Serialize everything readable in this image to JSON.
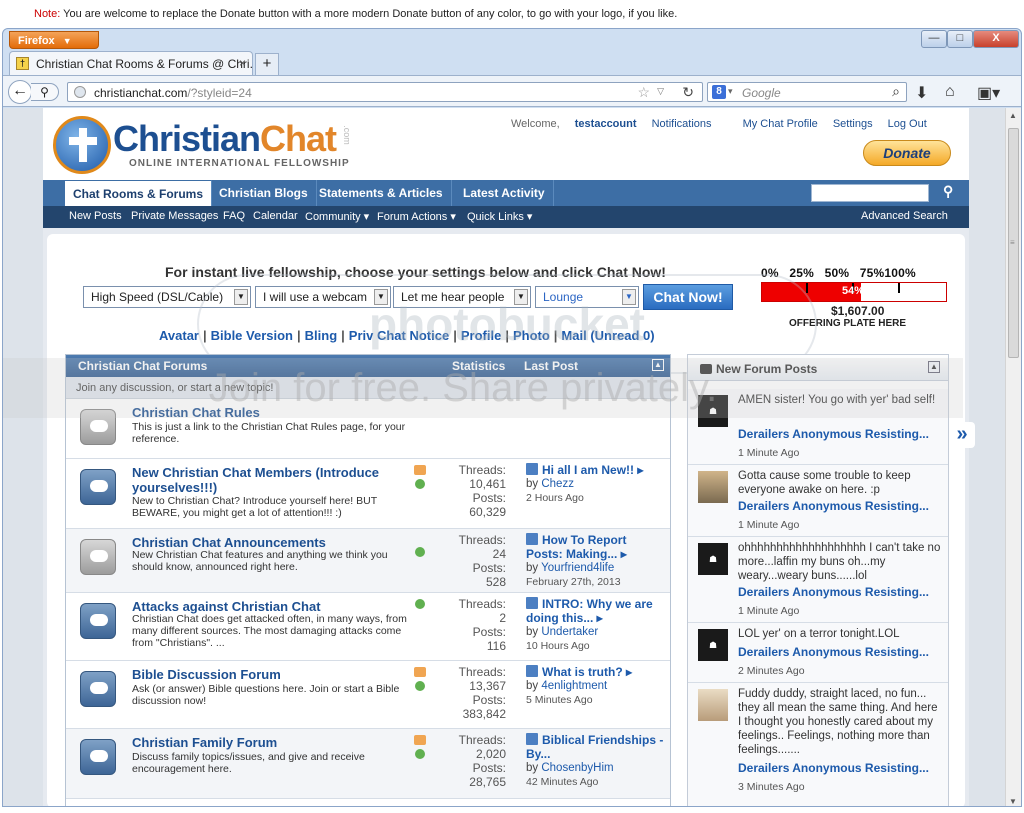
{
  "note": {
    "label": "Note:",
    "text": "You are welcome to replace the Donate button with a more modern Donate button of any color, to go with your logo, if you like."
  },
  "browser": {
    "menu_label": "Firefox",
    "tab_title": "Christian Chat Rooms & Forums @ Chri...",
    "url_host": "christianchat.com",
    "url_path": "/?styleid=24",
    "search_placeholder": "Google",
    "window_buttons": {
      "minimize": "—",
      "maximize": "□",
      "close": "X"
    }
  },
  "site": {
    "logo_main": "Christian",
    "logo_accent": "Chat",
    "logo_sub": "ONLINE INTERNATIONAL FELLOWSHIP",
    "logo_com": ".com",
    "welcome": "Welcome,",
    "username": "testaccount",
    "toplinks": [
      "Notifications",
      "My Chat Profile",
      "Settings",
      "Log Out"
    ],
    "donate": "Donate",
    "tabs": [
      "Chat Rooms & Forums",
      "Christian Blogs",
      "Statements & Articles",
      "Latest Activity"
    ],
    "subnav": [
      "New Posts",
      "Private Messages",
      "FAQ",
      "Calendar",
      "Community ▾",
      "Forum Actions ▾",
      "Quick Links ▾"
    ],
    "advanced_search": "Advanced Search"
  },
  "chat": {
    "heading": "For instant live fellowship, choose your settings below and click Chat Now!",
    "selects": [
      "High Speed (DSL/Cable)",
      "I will use a webcam",
      "Let me hear people",
      "Lounge"
    ],
    "button": "Chat Now!",
    "links": [
      "Avatar",
      "Bible Version",
      "Bling",
      "Priv Chat Notice",
      "Profile",
      "Photo",
      "Mail (Unread 0)"
    ]
  },
  "plate": {
    "scale": "0%   25%   50%   75%100%",
    "percent_label": "54%",
    "percent": 54,
    "amount": "$1,607.00",
    "label": "OFFERING PLATE HERE"
  },
  "forums": {
    "header": "Christian Chat Forums",
    "col_stats": "Statistics",
    "col_last": "Last Post",
    "sub": "Join any discussion, or start a new topic!",
    "threads_label": "Threads:",
    "posts_label": "Posts:",
    "rows": [
      {
        "title": "Christian Chat Rules",
        "desc": "This is just a link to the Christian Chat Rules page, for your reference."
      },
      {
        "title": "New Christian Chat Members (Introduce yourselves!!!)",
        "desc": "New to Christian Chat? Introduce yourself here! BUT BEWARE, you might get a lot of attention!!! :)",
        "threads": "10,461",
        "posts": "60,329",
        "last_title": "Hi all I am New!!",
        "last_by": "Chezz",
        "last_time": "2 Hours Ago"
      },
      {
        "title": "Christian Chat Announcements",
        "desc": "New Christian Chat features and anything we think you should know, announced right here.",
        "threads": "24",
        "posts": "528",
        "last_title": "How To Report Posts: Making...",
        "last_by": "Yourfriend4life",
        "last_time": "February 27th, 2013"
      },
      {
        "title": "Attacks against Christian Chat",
        "desc": "Christian Chat does get attacked often, in many ways, from many different sources. The most damaging attacks come from \"Christians\". ...",
        "threads": "2",
        "posts": "116",
        "last_title": "INTRO: Why we are doing this...",
        "last_by": "Undertaker",
        "last_time": "10 Hours Ago"
      },
      {
        "title": "Bible Discussion Forum",
        "desc": "Ask (or answer) Bible questions here. Join or start a Bible discussion now!",
        "threads": "13,367",
        "posts": "383,842",
        "last_title": "What is truth?",
        "last_by": "4enlightment",
        "last_time": "5 Minutes Ago"
      },
      {
        "title": "Christian Family Forum",
        "desc": "Discuss family topics/issues, and give and receive encouragement here.",
        "threads": "2,020",
        "posts": "28,765",
        "last_title": "Biblical Friendships - By...",
        "last_by": "ChosenbyHim",
        "last_time": "42 Minutes Ago"
      }
    ],
    "by": "by"
  },
  "sidebar": {
    "title": "New Forum Posts",
    "items": [
      {
        "text": "AMEN sister! You go with yer' bad self!",
        "thread": "Derailers Anonymous Resisting...",
        "time": "1 Minute Ago"
      },
      {
        "text": "Gotta cause some trouble to keep everyone awake on here. :p",
        "thread": "Derailers Anonymous Resisting...",
        "time": "1 Minute Ago"
      },
      {
        "text": "ohhhhhhhhhhhhhhhhhhh I can't take no more...laffin my buns oh...my weary...weary buns......lol",
        "thread": "Derailers Anonymous Resisting...",
        "time": "1 Minute Ago"
      },
      {
        "text": "LOL yer' on a terror tonight.LOL",
        "thread": "Derailers Anonymous Resisting...",
        "time": "2 Minutes Ago"
      },
      {
        "text": "Fuddy duddy, straight laced, no fun... they all mean the same thing. And here I thought you honestly cared about my feelings.. Feelings, nothing more than feelings.......",
        "thread": "Derailers Anonymous Resisting...",
        "time": "3 Minutes Ago"
      }
    ]
  },
  "watermark": {
    "brand": "photobucket",
    "bar": "Join for free. Share privately."
  },
  "colors": {
    "nav": "#3d6ea5",
    "subnav": "#23456d",
    "accent": "#e2862a",
    "link": "#1d5aab"
  }
}
